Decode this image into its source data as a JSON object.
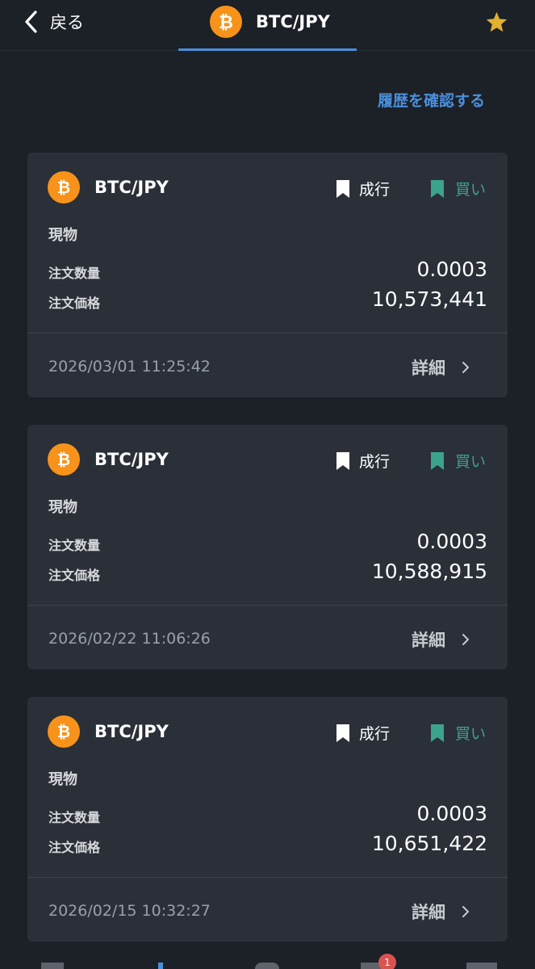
{
  "header": {
    "back_label": "戻る",
    "title": "BTC/JPY"
  },
  "history_link": "履歴を確認する",
  "orders": [
    {
      "pair": "BTC/JPY",
      "order_type": "成行",
      "side": "買い",
      "product": "現物",
      "qty_label": "注文数量",
      "qty": "0.0003",
      "price_label": "注文価格",
      "price": "10,573,441",
      "datetime": "2026/03/01 11:25:42",
      "detail_label": "詳細"
    },
    {
      "pair": "BTC/JPY",
      "order_type": "成行",
      "side": "買い",
      "product": "現物",
      "qty_label": "注文数量",
      "qty": "0.0003",
      "price_label": "注文価格",
      "price": "10,588,915",
      "datetime": "2026/02/22 11:06:26",
      "detail_label": "詳細"
    },
    {
      "pair": "BTC/JPY",
      "order_type": "成行",
      "side": "買い",
      "product": "現物",
      "qty_label": "注文数量",
      "qty": "0.0003",
      "price_label": "注文価格",
      "price": "10,651,422",
      "datetime": "2026/02/15 10:32:27",
      "detail_label": "詳細"
    }
  ],
  "bottom_nav": {
    "badge_count": "1"
  },
  "icons": {
    "back": "chevron-left-icon",
    "coin": "bitcoin-icon",
    "favorite": "star-icon",
    "order_type": "bookmark-icon",
    "side": "bookmark-icon",
    "detail": "chevron-right-icon"
  },
  "colors": {
    "background": "#1c2027",
    "card": "#2a2f38",
    "accent_blue": "#4a8fdb",
    "buy_green": "#3ca38c",
    "bitcoin_orange": "#f7931a",
    "star_gold": "#e0b030"
  }
}
